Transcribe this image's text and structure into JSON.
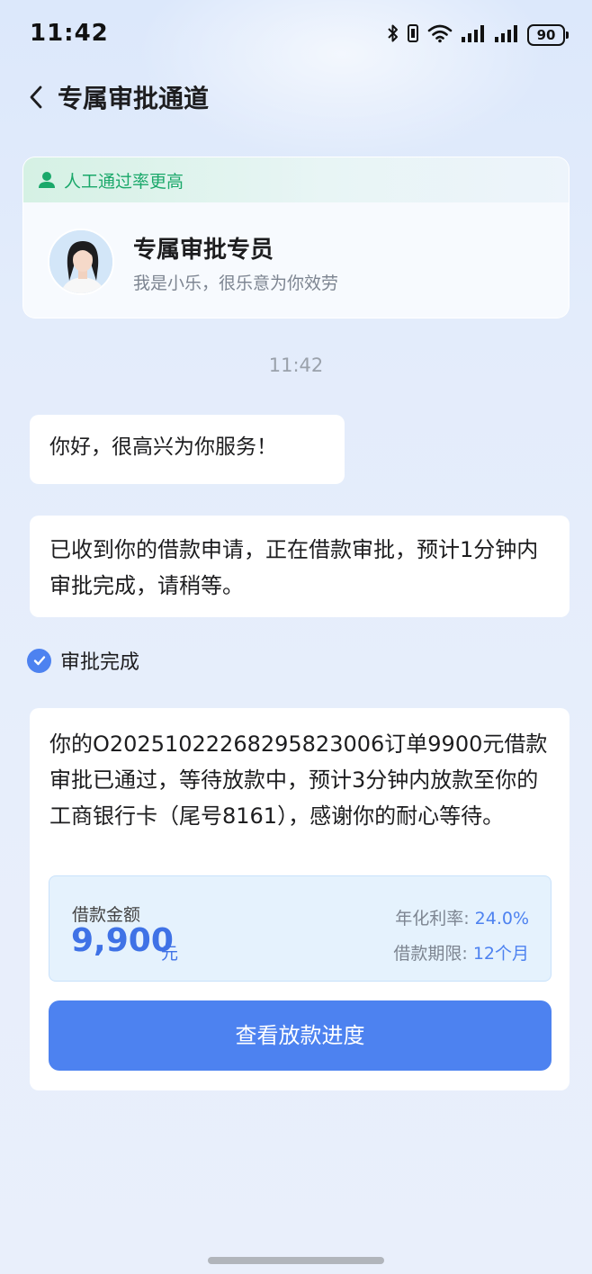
{
  "status_bar": {
    "time": "11:42",
    "battery": "90",
    "icons": [
      "bluetooth-icon",
      "vibrate-icon",
      "wifi-icon",
      "signal-icon",
      "signal-icon",
      "battery-icon"
    ]
  },
  "header": {
    "title": "专属审批通道",
    "back_icon": "chevron-left-icon"
  },
  "agent_card": {
    "rate_label": "人工通过率更高",
    "agent_name": "专属审批专员",
    "greeting": "我是小乐，很乐意为你效劳"
  },
  "chat": {
    "timestamp": "11:42",
    "message_1": "你好，很高兴为你服务！",
    "message_2": "已收到你的借款申请，正在借款审批，预计1分钟内审批完成，请稍等。",
    "approval_status": "审批完成",
    "message_3": "你的O20251022268295823006订单9900元借款审批已通过，等待放款中，预计3分钟内放款至你的工商银行卡（尾号8161），感谢你的耐心等待。"
  },
  "loan": {
    "amount_label": "借款金额",
    "amount": "9,900",
    "unit": "元",
    "rate_label": "年化利率:",
    "rate_value": "24.0%",
    "term_label": "借款期限:",
    "term_value": "12个月"
  },
  "actions": {
    "progress_button": "查看放款进度"
  },
  "colors": {
    "accent": "#4d82f0",
    "success": "#1aa86a",
    "background": "#e3ecfb"
  }
}
